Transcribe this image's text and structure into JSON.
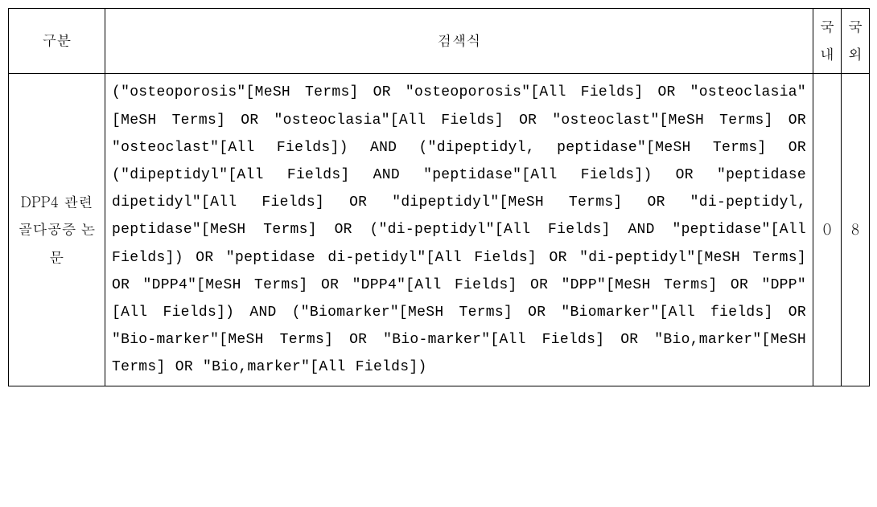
{
  "headers": {
    "category": "구분",
    "query": "검색식",
    "domestic": "국내",
    "foreign": "국외"
  },
  "row": {
    "category": "DPP4 관련 골다공증 논문",
    "query": "(\"osteoporosis\"[MeSH Terms] OR \"osteoporosis\"[All Fields] OR \"osteoclasia\"[MeSH Terms] OR \"osteoclasia\"[All Fields] OR \"osteoclast\"[MeSH Terms] OR \"osteoclast\"[All Fields]) AND (\"dipeptidyl, peptidase\"[MeSH Terms] OR (\"dipeptidyl\"[All Fields] AND \"peptidase\"[All Fields]) OR \"peptidase dipetidyl\"[All Fields] OR \"dipeptidyl\"[MeSH Terms] OR \"di-peptidyl, peptidase\"[MeSH Terms] OR (\"di-peptidyl\"[All Fields] AND \"peptidase\"[All Fields]) OR \"peptidase di-petidyl\"[All Fields] OR \"di-peptidyl\"[MeSH Terms] OR \"DPP4\"[MeSH Terms] OR \"DPP4\"[All Fields] OR \"DPP\"[MeSH Terms] OR \"DPP\"[All Fields]) AND (\"Biomarker\"[MeSH Terms] OR \"Biomarker\"[All fields] OR \"Bio-marker\"[MeSH Terms] OR \"Bio-marker\"[All Fields] OR \"Bio,marker\"[MeSH Terms] OR \"Bio,marker\"[All Fields])",
    "domestic": "0",
    "foreign": "8"
  }
}
